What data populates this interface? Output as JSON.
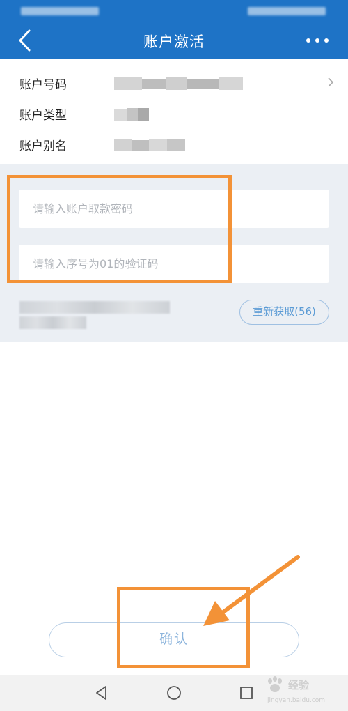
{
  "header": {
    "title": "账户激活",
    "back_icon": "chevron-left-icon",
    "more_icon": "more-dots-icon",
    "color": "#1e73c6"
  },
  "account_info": {
    "rows": [
      {
        "label": "账户号码"
      },
      {
        "label": "账户类型"
      },
      {
        "label": "账户别名"
      }
    ]
  },
  "form": {
    "password_placeholder": "请输入账户取款密码",
    "code_placeholder": "请输入序号为01的验证码",
    "resend_label": "重新获取(56)"
  },
  "confirm": {
    "label": "确认"
  },
  "nav": {
    "back_icon": "nav-back-icon",
    "home_icon": "nav-home-icon",
    "recents_icon": "nav-recents-icon"
  },
  "watermark": {
    "text": "经验",
    "url": "jingyan.baidu.com"
  },
  "annotation": {
    "color": "#f39237"
  }
}
